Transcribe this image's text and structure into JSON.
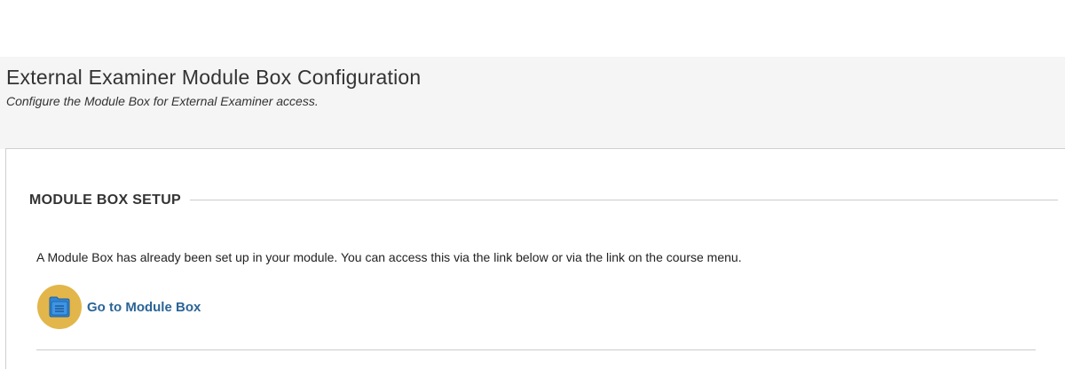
{
  "header": {
    "title": "External Examiner Module Box Configuration",
    "subtitle": "Configure the Module Box for External Examiner access."
  },
  "section": {
    "legend": "MODULE BOX SETUP",
    "info_text": "A Module Box has already been set up in your module. You can access this via the link below or via the link on the course menu.",
    "link_label": "Go to Module Box",
    "link_icon": "folder-icon"
  },
  "colors": {
    "header_bg": "#f5f5f5",
    "icon_circle": "#e2b64b",
    "folder_blue": "#2f86d6",
    "link_text": "#2a6496"
  }
}
